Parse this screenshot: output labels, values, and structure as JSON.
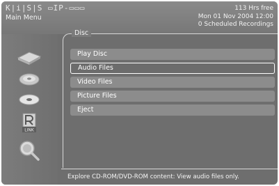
{
  "header": {
    "logo": "K|i|S|S ▭IP-▭▭▭",
    "menu_title": "Main Menu",
    "free_space": "113 Hrs free",
    "datetime": "Mon 01 Nov 2004 12:00",
    "scheduled": "0 Scheduled Recordings"
  },
  "panel": {
    "title": "Disc"
  },
  "menu": {
    "items": [
      {
        "label": "Play Disc",
        "selected": false
      },
      {
        "label": "Audio Files",
        "selected": true
      },
      {
        "label": "Video Files",
        "selected": false
      },
      {
        "label": "Picture Files",
        "selected": false
      },
      {
        "label": "Eject",
        "selected": false
      }
    ]
  },
  "sidebar": {
    "icons": [
      "tv-icon",
      "dvd-recorder-icon",
      "disc-icon",
      "kiss-link-icon",
      "search-icon"
    ],
    "link_label": "LINK"
  },
  "help": {
    "text": "Explore CD-ROM/DVD-ROM content: View audio files only."
  }
}
